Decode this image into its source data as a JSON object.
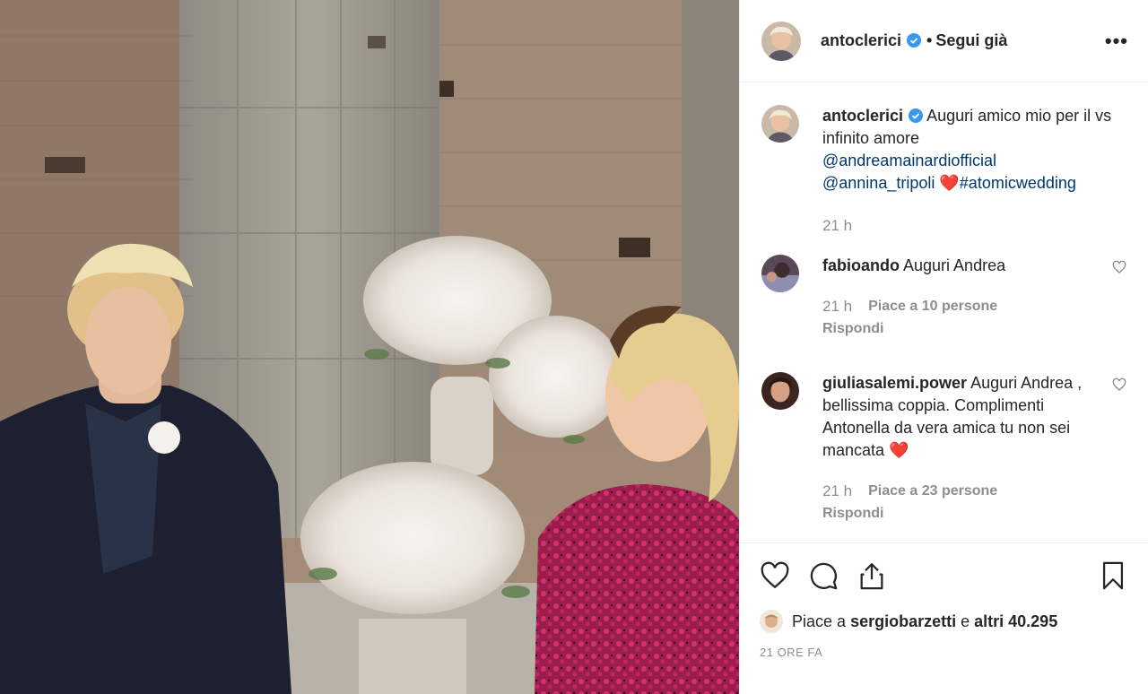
{
  "header": {
    "username": "antoclerici",
    "separator": "•",
    "follow_status": "Segui già",
    "more": "•••"
  },
  "caption": {
    "username": "antoclerici",
    "text": "Auguri amico mio per il vs infinito amore",
    "mention1": "@andreamainardiofficial",
    "mention2": "@annina_tripoli",
    "heart": "❤️",
    "hashtag": "#atomicwedding",
    "time": "21 h"
  },
  "comments": [
    {
      "username": "fabioando",
      "text": "Auguri Andrea",
      "time": "21 h",
      "likes": "Piace a 10 persone",
      "reply": "Rispondi"
    },
    {
      "username": "giuliasalemi.power",
      "text": "Auguri Andrea , bellissima coppia. Complimenti Antonella da vera amica tu non sei mancata",
      "heart": "❤️",
      "time": "21 h",
      "likes": "Piace a 23 persone",
      "reply": "Rispondi"
    }
  ],
  "likes_line": {
    "prefix": "Piace a",
    "user": "sergiobarzetti",
    "middle": "e",
    "others": "altri 40.295"
  },
  "timestamp": "21 ORE FA",
  "icons": {
    "like": "heart-icon",
    "comment": "comment-icon",
    "share": "share-icon",
    "save": "bookmark-icon",
    "verified": "verified-badge-icon"
  },
  "colors": {
    "text": "#262626",
    "muted": "#8e8e8e",
    "link": "#00376b",
    "verified": "#3897f0",
    "heart": "#ed4956"
  }
}
